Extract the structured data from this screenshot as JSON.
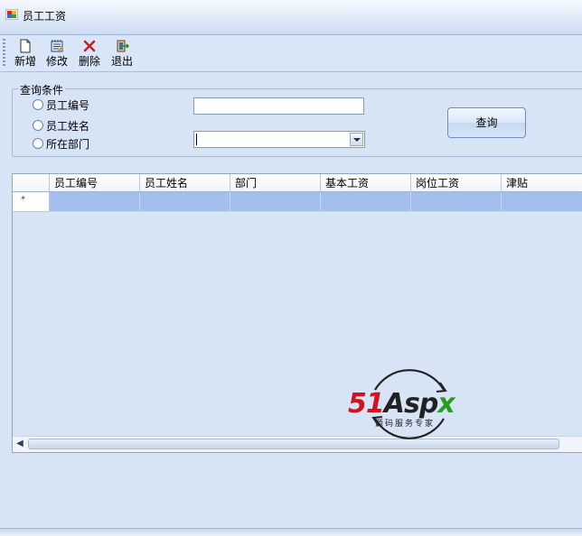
{
  "window": {
    "title": "员工工资"
  },
  "toolbar": {
    "items": [
      {
        "label": "新增",
        "icon": "new-page-icon"
      },
      {
        "label": "修改",
        "icon": "edit-icon"
      },
      {
        "label": "删除",
        "icon": "delete-icon"
      },
      {
        "label": "退出",
        "icon": "exit-icon"
      }
    ]
  },
  "search": {
    "group_title": "查询条件",
    "options": [
      {
        "label": "员工编号"
      },
      {
        "label": "员工姓名"
      },
      {
        "label": "所在部门"
      }
    ],
    "text_value": "",
    "dept_value": "",
    "query_label": "查询"
  },
  "grid": {
    "columns": [
      "员工编号",
      "员工姓名",
      "部门",
      "基本工资",
      "岗位工资",
      "津贴"
    ],
    "new_row_marker": "*",
    "selection_color": "#a3c0ec"
  },
  "watermark": {
    "brand_51": "51",
    "brand_asp": "Asp",
    "brand_x": "x",
    "tagline": "源码服务专家"
  }
}
